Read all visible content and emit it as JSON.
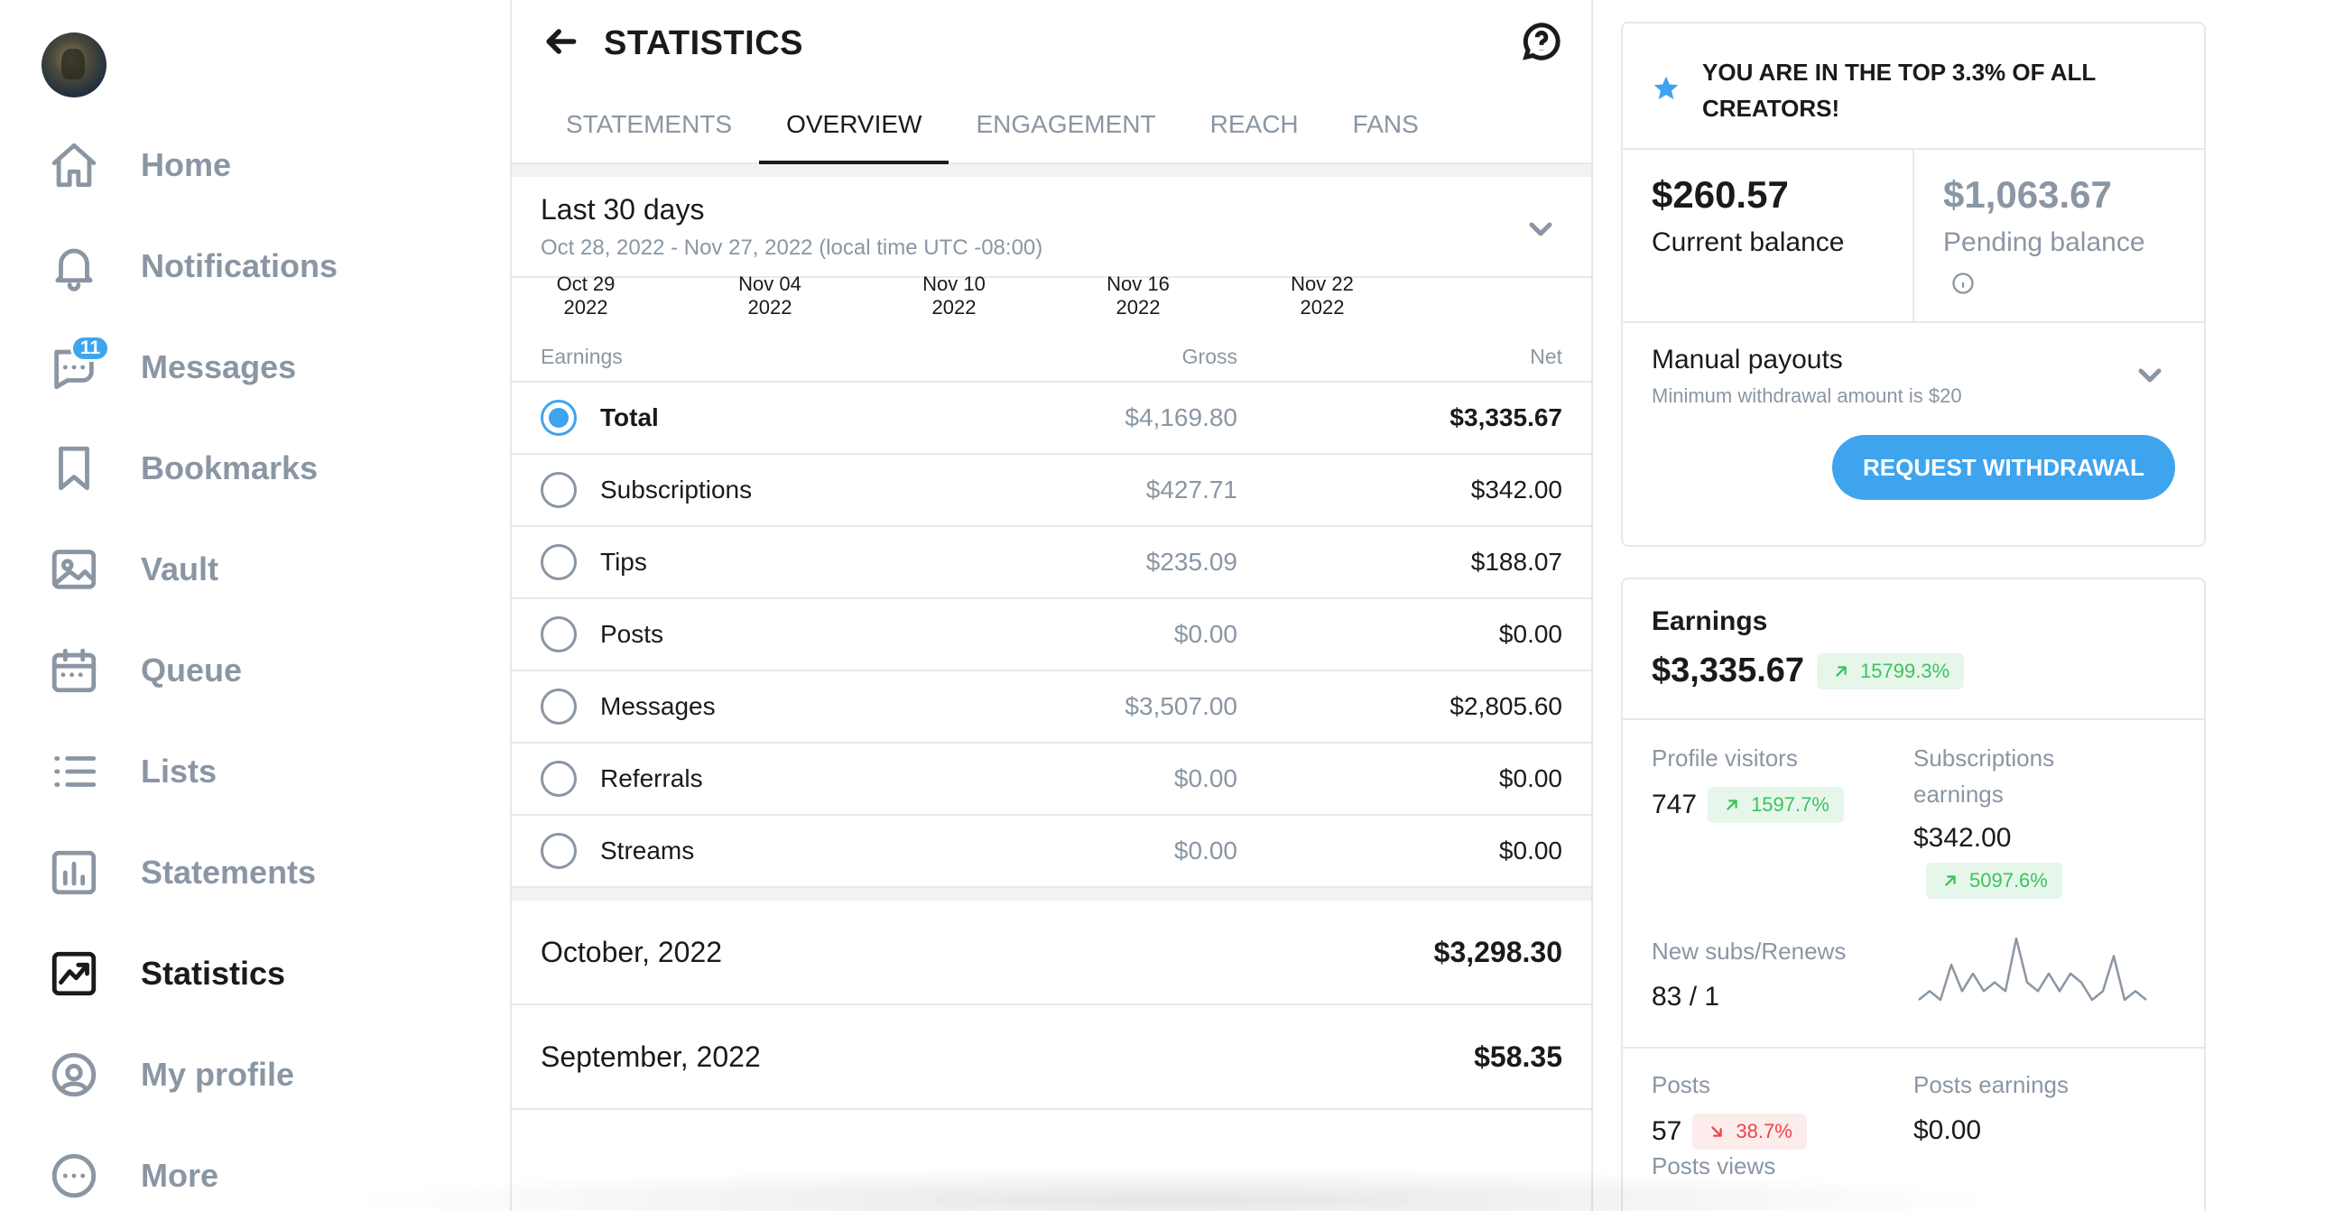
{
  "sidebar": {
    "items": [
      {
        "label": "Home",
        "icon": "home-icon"
      },
      {
        "label": "Notifications",
        "icon": "bell-icon"
      },
      {
        "label": "Messages",
        "icon": "message-icon",
        "badge": "11"
      },
      {
        "label": "Bookmarks",
        "icon": "bookmark-icon"
      },
      {
        "label": "Vault",
        "icon": "image-icon"
      },
      {
        "label": "Queue",
        "icon": "calendar-icon"
      },
      {
        "label": "Lists",
        "icon": "list-icon"
      },
      {
        "label": "Statements",
        "icon": "bar-chart-icon"
      },
      {
        "label": "Statistics",
        "icon": "trend-icon",
        "active": true
      },
      {
        "label": "My profile",
        "icon": "user-circle-icon"
      },
      {
        "label": "More",
        "icon": "more-icon"
      }
    ]
  },
  "header": {
    "title": "STATISTICS"
  },
  "tabs": [
    {
      "label": "STATEMENTS"
    },
    {
      "label": "OVERVIEW",
      "active": true
    },
    {
      "label": "ENGAGEMENT"
    },
    {
      "label": "REACH"
    },
    {
      "label": "FANS"
    }
  ],
  "period": {
    "title": "Last 30 days",
    "range": "Oct 28, 2022 - Nov 27, 2022 (local time UTC -08:00)"
  },
  "chart_axis": {
    "ticks": [
      {
        "date": "Oct 29",
        "year": "2022"
      },
      {
        "date": "Nov 04",
        "year": "2022"
      },
      {
        "date": "Nov 10",
        "year": "2022"
      },
      {
        "date": "Nov 16",
        "year": "2022"
      },
      {
        "date": "Nov 22",
        "year": "2022"
      }
    ]
  },
  "earnings_table": {
    "headers": {
      "category": "Earnings",
      "gross": "Gross",
      "net": "Net"
    },
    "rows": [
      {
        "label": "Total",
        "gross": "$4,169.80",
        "net": "$3,335.67",
        "selected": true
      },
      {
        "label": "Subscriptions",
        "gross": "$427.71",
        "net": "$342.00"
      },
      {
        "label": "Tips",
        "gross": "$235.09",
        "net": "$188.07"
      },
      {
        "label": "Posts",
        "gross": "$0.00",
        "net": "$0.00"
      },
      {
        "label": "Messages",
        "gross": "$3,507.00",
        "net": "$2,805.60"
      },
      {
        "label": "Referrals",
        "gross": "$0.00",
        "net": "$0.00"
      },
      {
        "label": "Streams",
        "gross": "$0.00",
        "net": "$0.00"
      }
    ]
  },
  "monthly": [
    {
      "month": "October, 2022",
      "value": "$3,298.30"
    },
    {
      "month": "September, 2022",
      "value": "$58.35"
    }
  ],
  "balance_card": {
    "banner": "YOU ARE IN THE TOP 3.3% OF ALL CREATORS!",
    "current_value": "$260.57",
    "current_label": "Current balance",
    "pending_value": "$1,063.67",
    "pending_label": "Pending balance",
    "payout_title": "Manual payouts",
    "payout_sub": "Minimum withdrawal amount is $20",
    "withdraw_label": "REQUEST WITHDRAWAL"
  },
  "earnings_card": {
    "title": "Earnings",
    "value": "$3,335.67",
    "change": "15799.3%",
    "profile_visitors_label": "Profile visitors",
    "profile_visitors_value": "747",
    "profile_visitors_change": "1597.7%",
    "subs_earnings_label": "Subscriptions earnings",
    "subs_earnings_value": "$342.00",
    "subs_earnings_change": "5097.6%",
    "new_subs_label": "New subs/Renews",
    "new_subs_value": "83 / 1",
    "sparkline": [
      2,
      3,
      2,
      6,
      3,
      5,
      3,
      4,
      3,
      9,
      4,
      3,
      5,
      3,
      5,
      4,
      2,
      3,
      7,
      2,
      3,
      2
    ],
    "posts_label": "Posts",
    "posts_value": "57",
    "posts_change": "38.7%",
    "posts_earnings_label": "Posts earnings",
    "posts_earnings_value": "$0.00",
    "posts_views_label": "Posts views"
  },
  "colors": {
    "accent": "#3ea4ee",
    "muted": "#8a96a3",
    "up": "#3cc35c",
    "down": "#e8444a"
  }
}
